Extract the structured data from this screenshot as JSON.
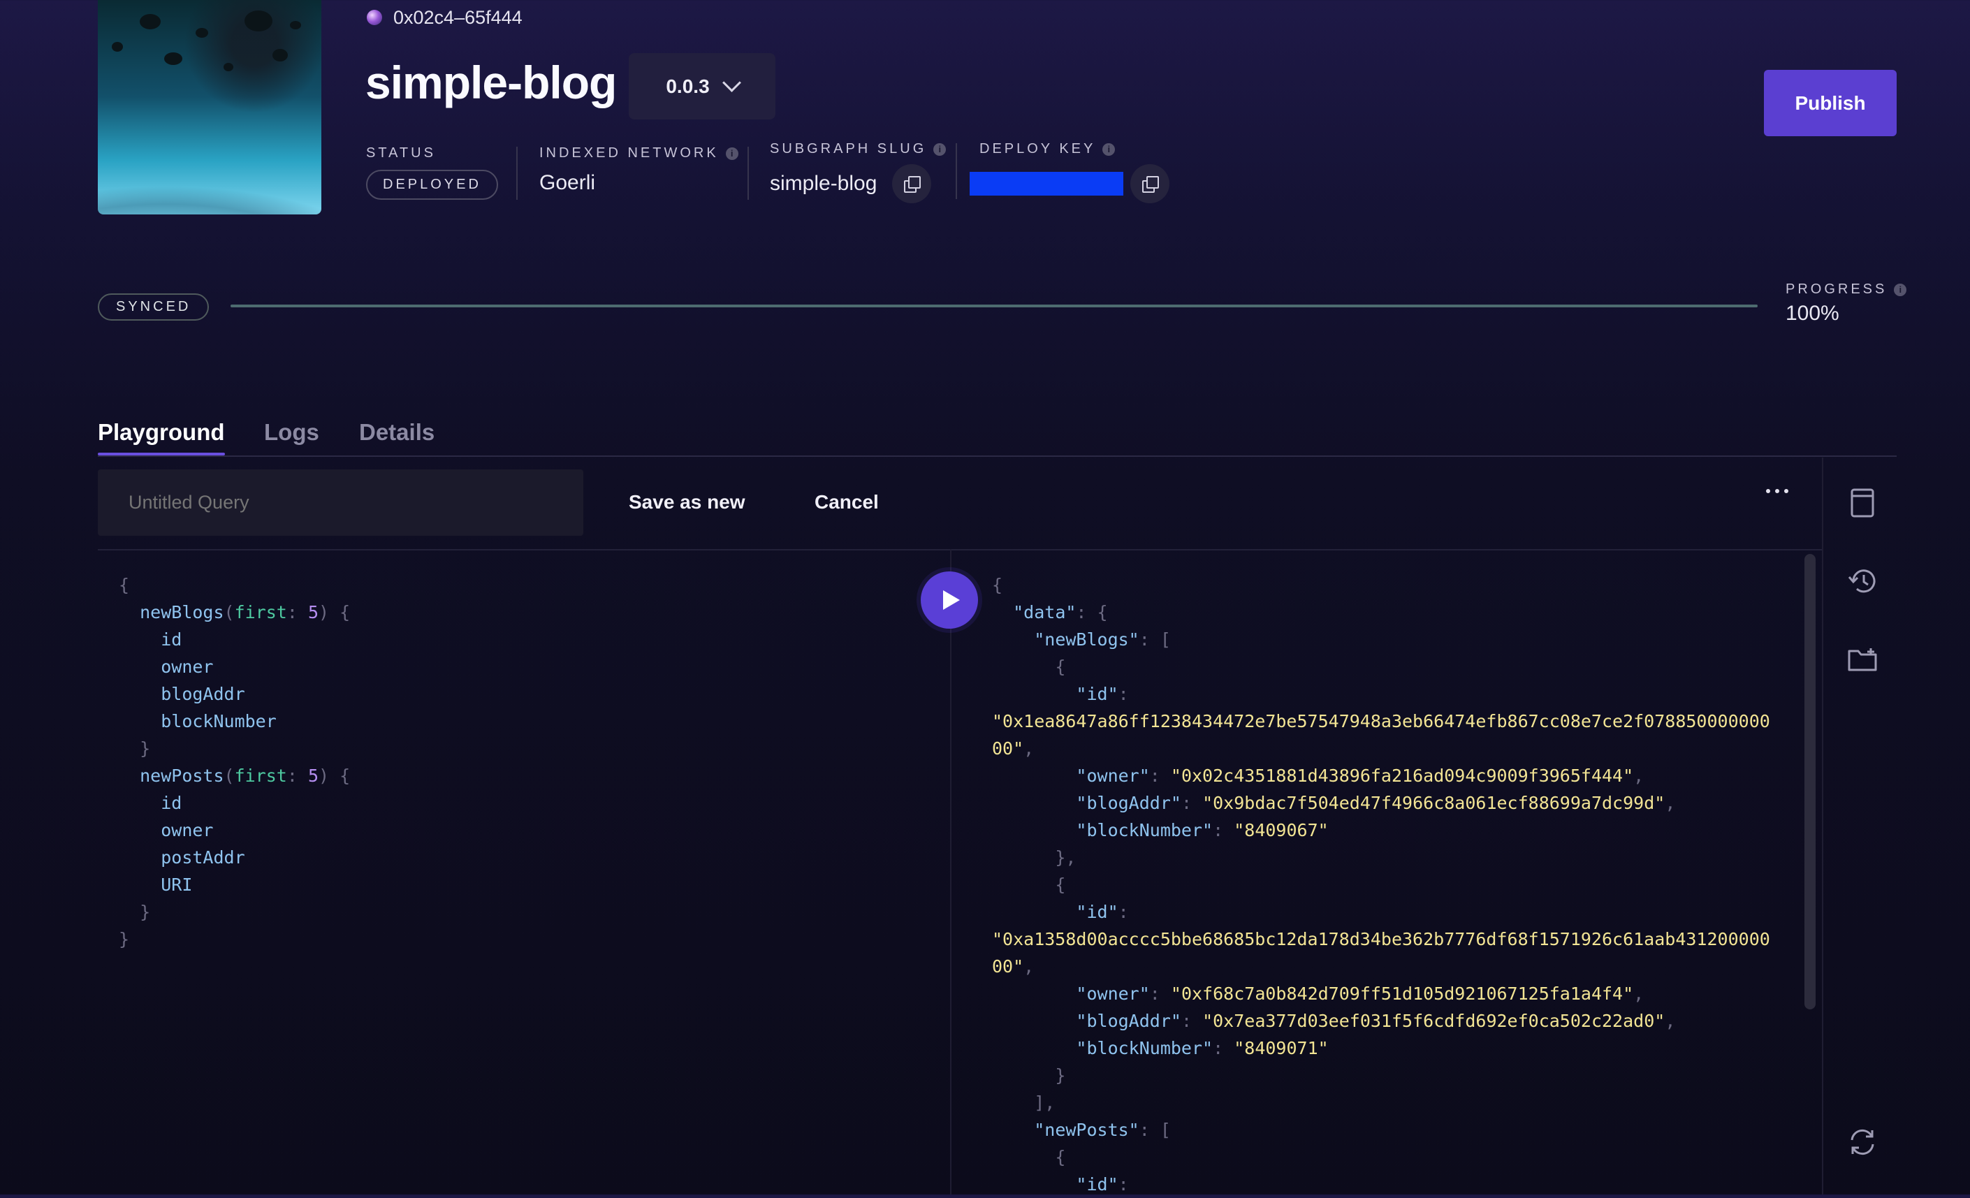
{
  "header": {
    "owner_address": "0x02c4–65f444",
    "title": "simple-blog",
    "version": "0.0.3",
    "status": {
      "label": "STATUS",
      "value": "DEPLOYED"
    },
    "network": {
      "label": "INDEXED NETWORK",
      "value": "Goerli"
    },
    "slug": {
      "label": "SUBGRAPH SLUG",
      "value": "simple-blog"
    },
    "deploy_key": {
      "label": "DEPLOY KEY",
      "masked_color": "#0a3cf5"
    },
    "publish_label": "Publish",
    "info_glyph": "i"
  },
  "sync": {
    "state": "SYNCED",
    "progress_label": "PROGRESS",
    "progress_value": "100%",
    "progress_fraction": 1.0
  },
  "tabs": [
    {
      "label": "Playground",
      "active": true
    },
    {
      "label": "Logs",
      "active": false
    },
    {
      "label": "Details",
      "active": false
    }
  ],
  "toolbar": {
    "query_placeholder": "Untitled Query",
    "save_label": "Save as new",
    "cancel_label": "Cancel"
  },
  "colors": {
    "accent": "#5b3fd1",
    "deploy_key": "#0a3cf5"
  },
  "icons": [
    "bookmark-icon",
    "history-icon",
    "folder-plus-icon",
    "refresh-icon",
    "play-icon",
    "copy-icon"
  ]
}
